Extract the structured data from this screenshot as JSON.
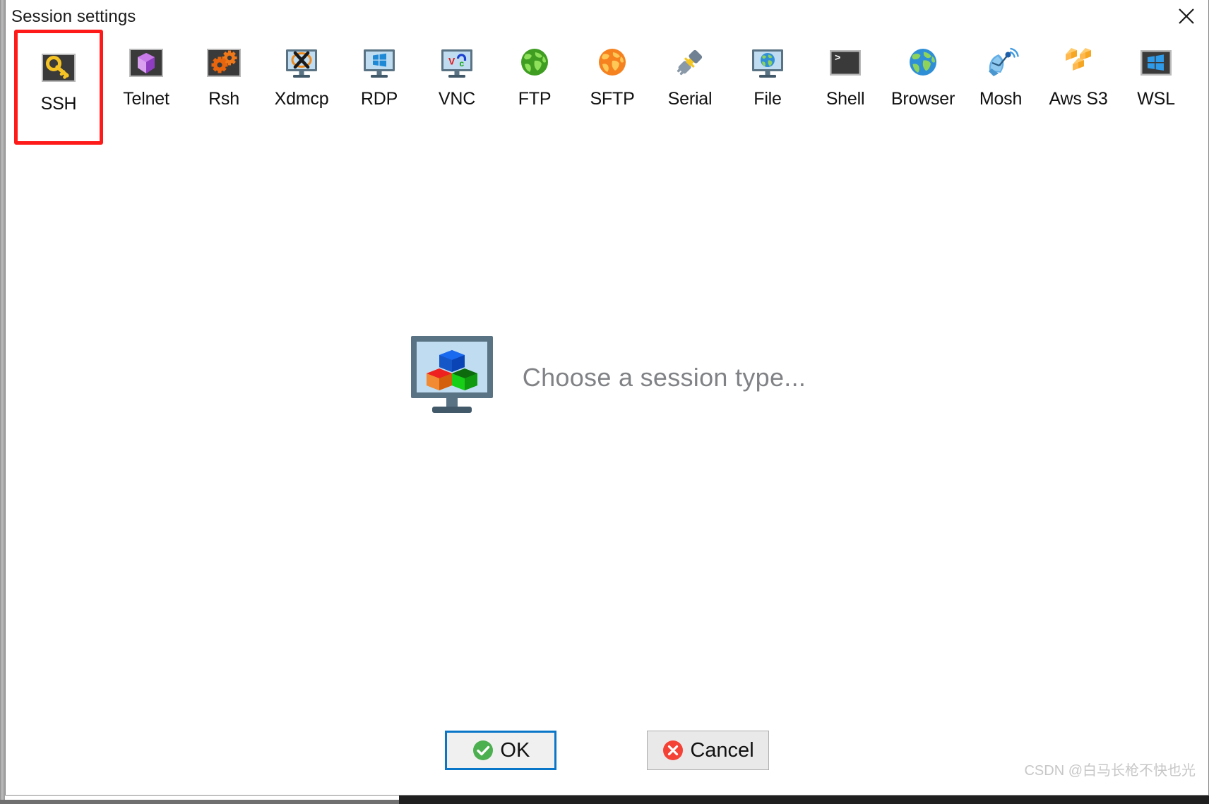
{
  "window": {
    "title": "Session settings",
    "close_icon": "close-icon"
  },
  "session_types": [
    {
      "id": "ssh",
      "label": "SSH",
      "icon": "key-icon",
      "selected": true
    },
    {
      "id": "telnet",
      "label": "Telnet",
      "icon": "gem-icon",
      "selected": false
    },
    {
      "id": "rsh",
      "label": "Rsh",
      "icon": "gears-icon",
      "selected": false
    },
    {
      "id": "xdmcp",
      "label": "Xdmcp",
      "icon": "monitor-x11-icon",
      "selected": false
    },
    {
      "id": "rdp",
      "label": "RDP",
      "icon": "monitor-windows-icon",
      "selected": false
    },
    {
      "id": "vnc",
      "label": "VNC",
      "icon": "monitor-vnc-icon",
      "selected": false
    },
    {
      "id": "ftp",
      "label": "FTP",
      "icon": "green-globe-icon",
      "selected": false
    },
    {
      "id": "sftp",
      "label": "SFTP",
      "icon": "orange-globe-icon",
      "selected": false
    },
    {
      "id": "serial",
      "label": "Serial",
      "icon": "plug-icon",
      "selected": false
    },
    {
      "id": "file",
      "label": "File",
      "icon": "monitor-globe-icon",
      "selected": false
    },
    {
      "id": "shell",
      "label": "Shell",
      "icon": "terminal-icon",
      "selected": false
    },
    {
      "id": "browser",
      "label": "Browser",
      "icon": "blue-globe-icon",
      "selected": false
    },
    {
      "id": "mosh",
      "label": "Mosh",
      "icon": "satellite-dish-icon",
      "selected": false
    },
    {
      "id": "awss3",
      "label": "Aws S3",
      "icon": "aws-cubes-icon",
      "selected": false
    },
    {
      "id": "wsl",
      "label": "WSL",
      "icon": "windows-tile-icon",
      "selected": false
    }
  ],
  "placeholder": {
    "text": "Choose a session type...",
    "icon": "monitor-cubes-icon"
  },
  "footer": {
    "ok_label": "OK",
    "ok_icon": "green-check-icon",
    "cancel_label": "Cancel",
    "cancel_icon": "red-x-icon"
  },
  "watermark": {
    "text": "CSDN @白马长枪不快也光"
  },
  "colors": {
    "selection_highlight": "#ff1a1a",
    "focus_border": "#0a76c8",
    "placeholder_text": "#808285",
    "ok_icon": "#4caf50",
    "cancel_icon": "#f44336"
  }
}
